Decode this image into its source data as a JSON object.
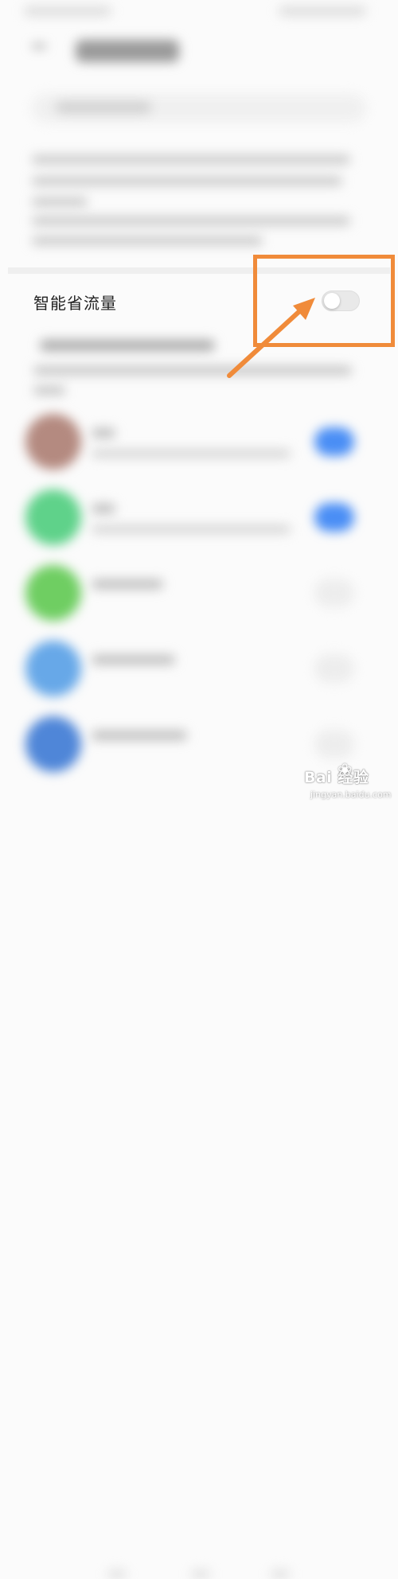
{
  "smart_save_row": {
    "label": "智能省流量",
    "toggle_state": "off"
  },
  "annotation": {
    "color": "#f08b3a"
  },
  "apps": [
    {
      "icon_color": "#b48a80",
      "switch": "on"
    },
    {
      "icon_color": "#5fd28a",
      "switch": "on"
    },
    {
      "icon_color": "#6fce62",
      "switch": "off"
    },
    {
      "icon_color": "#67a8e8",
      "switch": "off"
    },
    {
      "icon_color": "#4f86d8",
      "switch": "off"
    }
  ],
  "watermark": {
    "brand": "Bai  经验",
    "url": "jingyan.baidu.com"
  }
}
